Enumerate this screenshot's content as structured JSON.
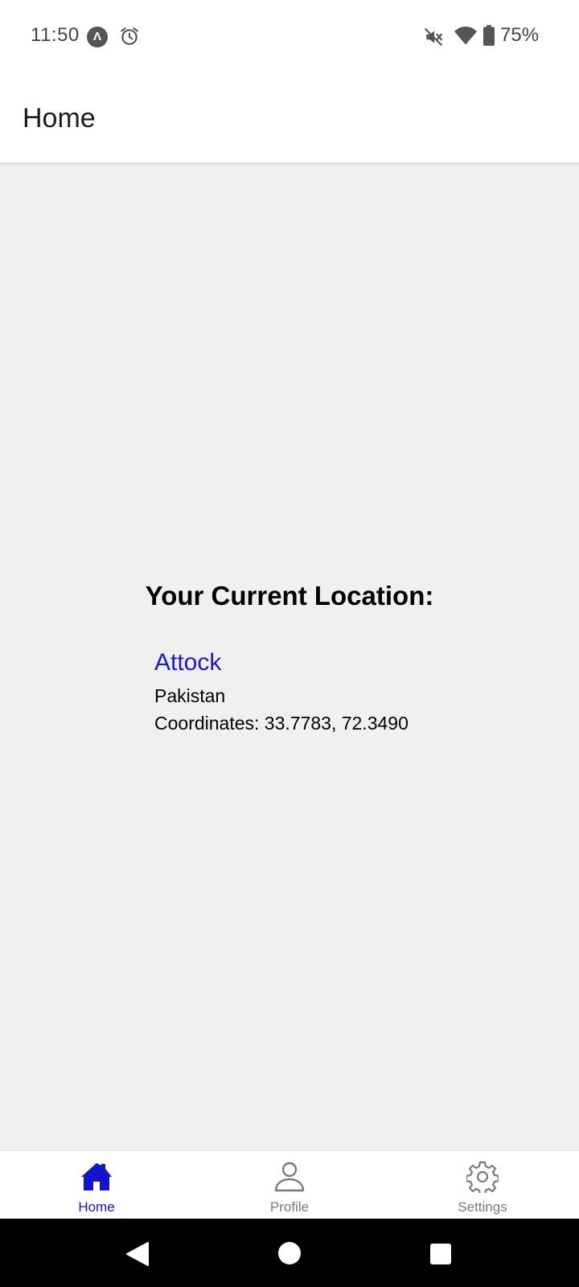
{
  "status_bar": {
    "time": "11:50",
    "app_icon_glyph": "Λ",
    "battery_percent": "75%",
    "icons": [
      "app-notification-icon",
      "alarm-icon",
      "mute-icon",
      "wifi-icon",
      "battery-icon"
    ]
  },
  "app_bar": {
    "title": "Home"
  },
  "location": {
    "heading": "Your Current Location:",
    "city": "Attock",
    "country": "Pakistan",
    "coordinates": "Coordinates: 33.7783, 72.3490"
  },
  "tabs": [
    {
      "label": "Home",
      "icon": "home-icon",
      "active": true
    },
    {
      "label": "Profile",
      "icon": "person-icon",
      "active": false
    },
    {
      "label": "Settings",
      "icon": "gear-icon",
      "active": false
    }
  ],
  "colors": {
    "accent": "#1414cc",
    "city_link": "#1a1ad6",
    "inactive_tab": "#7a7a7a",
    "background": "#f0f0f0"
  },
  "nav_bar": {
    "icons": [
      "back-icon",
      "home-circle-icon",
      "recents-icon"
    ]
  }
}
